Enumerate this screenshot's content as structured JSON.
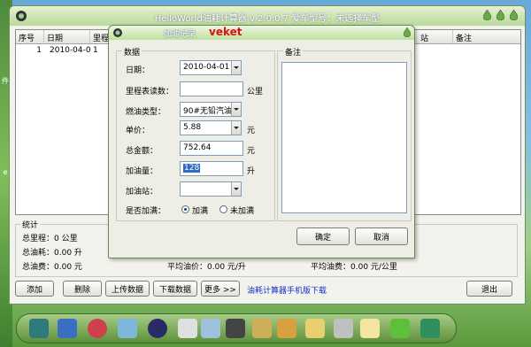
{
  "main_window": {
    "title": "HelloWorld油耗计算器 v 2.0.0.7  爱车型号：未选择车型",
    "table": {
      "columns": [
        "序号",
        "日期",
        "里程",
        "站",
        "备注"
      ],
      "rows": [
        [
          "1",
          "2010-04-01",
          "1",
          "",
          ""
        ]
      ]
    },
    "stats": {
      "legend": "统计",
      "total_mileage": "总里程：0 公里",
      "total_fuel": "总油耗：0.00 升",
      "total_cost": "总油费：0.00 元",
      "avg_price": "平均油价：0.00 元/升",
      "avg_cost": "平均油费：0.00 元/公里"
    },
    "buttons": {
      "add": "添加",
      "delete": "删除",
      "upload": "上传数据",
      "download": "下载数据",
      "more": "更多 >>",
      "exit": "退出"
    },
    "mobile_link": "油耗计算器手机版下载"
  },
  "dialog": {
    "title": "加油记录",
    "tag": "veket",
    "data_legend": "数据",
    "notes_legend": "备注",
    "date_label": "日期：",
    "date_value": "2010-04-01",
    "odometer_label": "里程表读数：",
    "odometer_value": "",
    "odometer_unit": "公里",
    "fuel_type_label": "燃油类型：",
    "fuel_type_value": "90#无铅汽油",
    "unit_price_label": "单价：",
    "unit_price_value": "5.88",
    "unit_price_unit": "元",
    "total_amount_label": "总金额：",
    "total_amount_value": "752.64",
    "total_amount_unit": "元",
    "fuel_amount_label": "加油量：",
    "fuel_amount_value": "128",
    "fuel_amount_unit": "升",
    "station_label": "加油站：",
    "station_value": "",
    "full_tank_label": "是否加满：",
    "option_full": "加满",
    "option_not_full": "未加满",
    "notes_value": "",
    "ok": "确定",
    "cancel": "取消"
  },
  "colors": {
    "title_green": "#b9d99a",
    "link_blue": "#1030c8",
    "tag_red": "#e01010"
  }
}
